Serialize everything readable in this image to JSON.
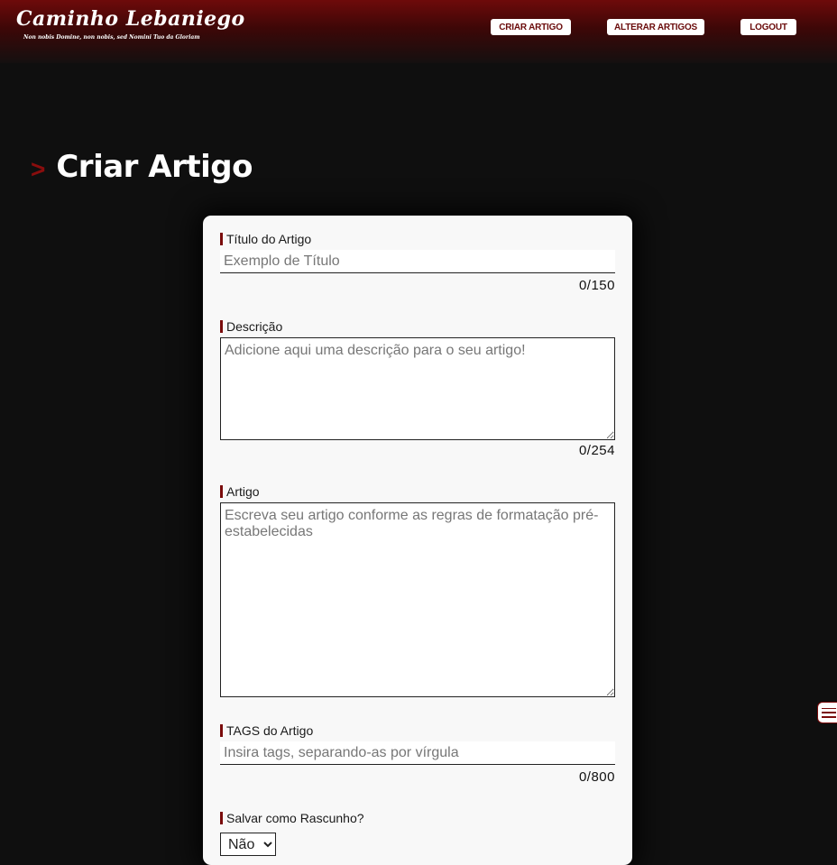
{
  "header": {
    "logo_title": "Caminho Lebaniego",
    "logo_motto": "Non nobis Domine, non nobis, sed Nomini Tuo da Gloriam",
    "nav": [
      {
        "label": "CRIAR ARTIGO"
      },
      {
        "label": "ALTERAR ARTIGOS"
      },
      {
        "label": "LOGOUT"
      }
    ]
  },
  "page": {
    "chevron": ">",
    "title": "Criar Artigo"
  },
  "form": {
    "title_field": {
      "label": "Título do Artigo",
      "placeholder": "Exemplo de Título",
      "value": "",
      "counter": "0/150"
    },
    "description_field": {
      "label": "Descrição",
      "placeholder": "Adicione aqui uma descrição para o seu artigo!",
      "value": "",
      "counter": "0/254"
    },
    "article_field": {
      "label": "Artigo",
      "placeholder": "Escreva seu artigo conforme as regras de formatação pré-estabelecidas",
      "value": ""
    },
    "tags_field": {
      "label": "TAGS do Artigo",
      "placeholder": "Insira tags, separando-as por vírgula",
      "value": "",
      "counter": "0/800"
    },
    "draft_field": {
      "label": "Salvar como Rascunho?",
      "selected": "Não"
    }
  },
  "icons": {
    "side_menu": "hamburger-menu-icon"
  },
  "colors": {
    "accent": "#7a0b0b",
    "header_top": "#6e0a0a",
    "background": "#0f0f0f",
    "card": "#f8f8f8"
  }
}
